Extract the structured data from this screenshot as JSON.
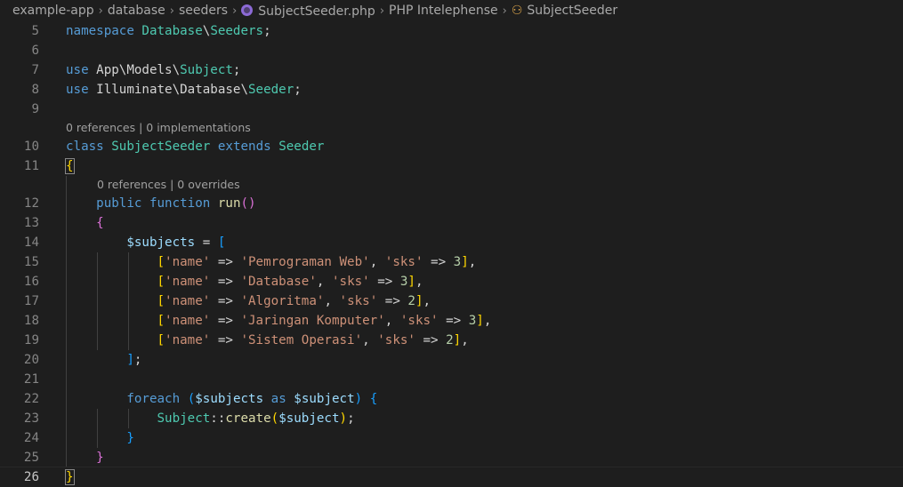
{
  "breadcrumb": {
    "items": [
      "example-app",
      "database",
      "seeders",
      "SubjectSeeder.php",
      "PHP Intelephense",
      "SubjectSeeder"
    ]
  },
  "editor": {
    "language": "php",
    "lines": [
      {
        "num": "5",
        "tokens": [
          [
            "kw",
            "namespace"
          ],
          [
            "txt",
            " "
          ],
          [
            "cls",
            "Database"
          ],
          [
            "txt",
            "\\"
          ],
          [
            "cls",
            "Seeders"
          ],
          [
            "txt",
            ";"
          ]
        ]
      },
      {
        "num": "6",
        "tokens": []
      },
      {
        "num": "7",
        "tokens": [
          [
            "kw",
            "use"
          ],
          [
            "txt",
            " App\\Models\\"
          ],
          [
            "cls",
            "Subject"
          ],
          [
            "txt",
            ";"
          ]
        ]
      },
      {
        "num": "8",
        "tokens": [
          [
            "kw",
            "use"
          ],
          [
            "txt",
            " Illuminate\\Database\\"
          ],
          [
            "cls",
            "Seeder"
          ],
          [
            "txt",
            ";"
          ]
        ]
      },
      {
        "num": "9",
        "tokens": []
      },
      {
        "lens": "0 references | 0 implementations",
        "indent": 0
      },
      {
        "num": "10",
        "tokens": [
          [
            "kw",
            "class"
          ],
          [
            "txt",
            " "
          ],
          [
            "cls",
            "SubjectSeeder"
          ],
          [
            "txt",
            " "
          ],
          [
            "kw",
            "extends"
          ],
          [
            "txt",
            " "
          ],
          [
            "cls",
            "Seeder"
          ]
        ]
      },
      {
        "num": "11",
        "tokens": [
          [
            "p1 bm",
            "{"
          ]
        ]
      },
      {
        "lens": "0 references | 0 overrides",
        "indent": 1
      },
      {
        "num": "12",
        "tokens": [
          [
            "txt",
            "    "
          ],
          [
            "kw",
            "public"
          ],
          [
            "txt",
            " "
          ],
          [
            "kw",
            "function"
          ],
          [
            "txt",
            " "
          ],
          [
            "fn",
            "run"
          ],
          [
            "p2",
            "()"
          ]
        ]
      },
      {
        "num": "13",
        "tokens": [
          [
            "txt",
            "    "
          ],
          [
            "p2",
            "{"
          ]
        ]
      },
      {
        "num": "14",
        "tokens": [
          [
            "txt",
            "        "
          ],
          [
            "var",
            "$subjects"
          ],
          [
            "txt",
            " = "
          ],
          [
            "p3",
            "["
          ]
        ]
      },
      {
        "num": "15",
        "tokens": [
          [
            "txt",
            "            "
          ],
          [
            "p1",
            "["
          ],
          [
            "str",
            "'name'"
          ],
          [
            "txt",
            " => "
          ],
          [
            "str",
            "'Pemrograman Web'"
          ],
          [
            "txt",
            ", "
          ],
          [
            "str",
            "'sks'"
          ],
          [
            "txt",
            " => "
          ],
          [
            "num",
            "3"
          ],
          [
            "p1",
            "]"
          ],
          [
            "txt",
            ","
          ]
        ]
      },
      {
        "num": "16",
        "tokens": [
          [
            "txt",
            "            "
          ],
          [
            "p1",
            "["
          ],
          [
            "str",
            "'name'"
          ],
          [
            "txt",
            " => "
          ],
          [
            "str",
            "'Database'"
          ],
          [
            "txt",
            ", "
          ],
          [
            "str",
            "'sks'"
          ],
          [
            "txt",
            " => "
          ],
          [
            "num",
            "3"
          ],
          [
            "p1",
            "]"
          ],
          [
            "txt",
            ","
          ]
        ]
      },
      {
        "num": "17",
        "tokens": [
          [
            "txt",
            "            "
          ],
          [
            "p1",
            "["
          ],
          [
            "str",
            "'name'"
          ],
          [
            "txt",
            " => "
          ],
          [
            "str",
            "'Algoritma'"
          ],
          [
            "txt",
            ", "
          ],
          [
            "str",
            "'sks'"
          ],
          [
            "txt",
            " => "
          ],
          [
            "num",
            "2"
          ],
          [
            "p1",
            "]"
          ],
          [
            "txt",
            ","
          ]
        ]
      },
      {
        "num": "18",
        "tokens": [
          [
            "txt",
            "            "
          ],
          [
            "p1",
            "["
          ],
          [
            "str",
            "'name'"
          ],
          [
            "txt",
            " => "
          ],
          [
            "str",
            "'Jaringan Komputer'"
          ],
          [
            "txt",
            ", "
          ],
          [
            "str",
            "'sks'"
          ],
          [
            "txt",
            " => "
          ],
          [
            "num",
            "3"
          ],
          [
            "p1",
            "]"
          ],
          [
            "txt",
            ","
          ]
        ]
      },
      {
        "num": "19",
        "tokens": [
          [
            "txt",
            "            "
          ],
          [
            "p1",
            "["
          ],
          [
            "str",
            "'name'"
          ],
          [
            "txt",
            " => "
          ],
          [
            "str",
            "'Sistem Operasi'"
          ],
          [
            "txt",
            ", "
          ],
          [
            "str",
            "'sks'"
          ],
          [
            "txt",
            " => "
          ],
          [
            "num",
            "2"
          ],
          [
            "p1",
            "]"
          ],
          [
            "txt",
            ","
          ]
        ]
      },
      {
        "num": "20",
        "tokens": [
          [
            "txt",
            "        "
          ],
          [
            "p3",
            "]"
          ],
          [
            "txt",
            ";"
          ]
        ]
      },
      {
        "num": "21",
        "tokens": []
      },
      {
        "num": "22",
        "tokens": [
          [
            "txt",
            "        "
          ],
          [
            "kw",
            "foreach"
          ],
          [
            "txt",
            " "
          ],
          [
            "p3",
            "("
          ],
          [
            "var",
            "$subjects"
          ],
          [
            "txt",
            " "
          ],
          [
            "kw",
            "as"
          ],
          [
            "txt",
            " "
          ],
          [
            "var",
            "$subject"
          ],
          [
            "p3",
            ")"
          ],
          [
            "txt",
            " "
          ],
          [
            "p3",
            "{"
          ]
        ]
      },
      {
        "num": "23",
        "tokens": [
          [
            "txt",
            "            "
          ],
          [
            "cls",
            "Subject"
          ],
          [
            "txt",
            "::"
          ],
          [
            "fn",
            "create"
          ],
          [
            "p1",
            "("
          ],
          [
            "var",
            "$subject"
          ],
          [
            "p1",
            ")"
          ],
          [
            "txt",
            ";"
          ]
        ]
      },
      {
        "num": "24",
        "tokens": [
          [
            "txt",
            "        "
          ],
          [
            "p3",
            "}"
          ]
        ]
      },
      {
        "num": "25",
        "tokens": [
          [
            "txt",
            "    "
          ],
          [
            "p2",
            "}"
          ]
        ]
      },
      {
        "num": "26",
        "tokens": [
          [
            "p1 bm",
            "}"
          ]
        ],
        "current": true
      }
    ]
  }
}
